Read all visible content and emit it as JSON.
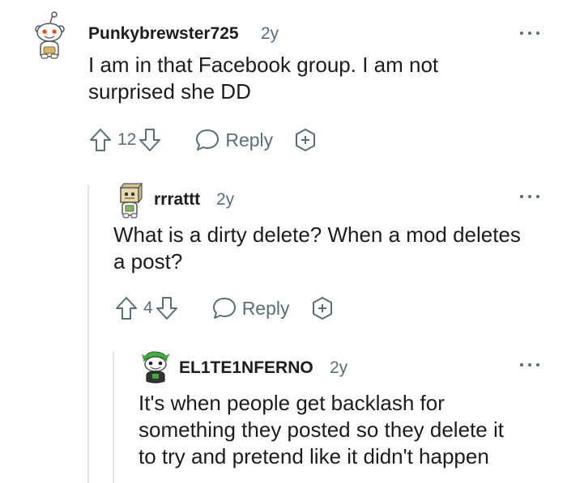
{
  "colors": {
    "text": "#1c1c1c",
    "meta": "#576f76",
    "thread_line": "#e1e3e6",
    "snoo_red": "#ff4500"
  },
  "comments": [
    {
      "username": "Punkybrewster725",
      "age": "2y",
      "body_lines": [
        "I am in that Facebook group. I am not",
        "surprised she DD"
      ],
      "score": "12",
      "reply_label": "Reply",
      "avatar_icon": "snoo-default-avatar"
    },
    {
      "username": "rrrattt",
      "age": "2y",
      "body_lines": [
        "What is a dirty delete? When a mod deletes",
        "a post?"
      ],
      "score": "4",
      "reply_label": "Reply",
      "avatar_icon": "snoo-box-hat-avatar"
    },
    {
      "username": "EL1TE1NFERNO",
      "age": "2y",
      "body_lines": [
        "It's when people get backlash for",
        "something they posted so they delete it",
        "to try and pretend like it didn't happen"
      ],
      "avatar_icon": "snoo-green-hair-avatar"
    }
  ]
}
